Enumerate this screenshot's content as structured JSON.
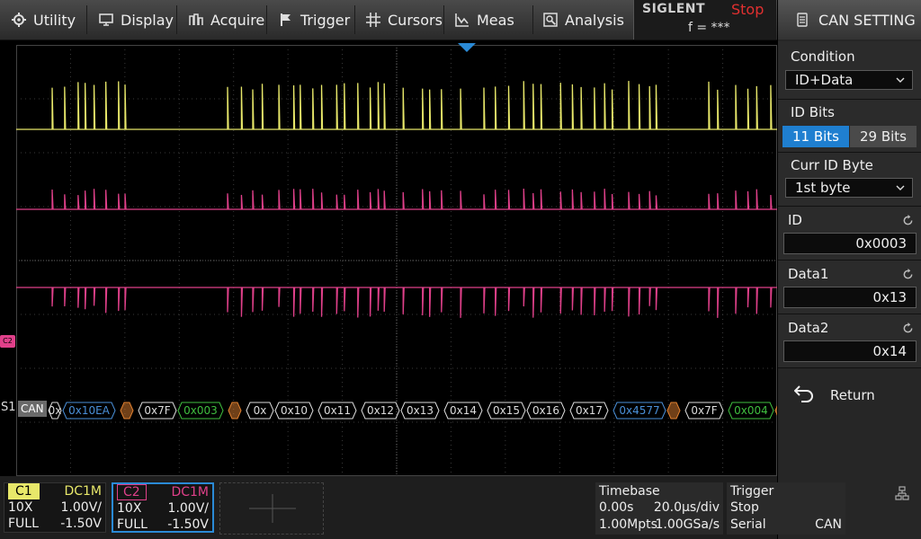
{
  "menu": {
    "items": [
      {
        "label": "Utility",
        "icon": "utility-icon"
      },
      {
        "label": "Display",
        "icon": "display-icon"
      },
      {
        "label": "Acquire",
        "icon": "acquire-icon"
      },
      {
        "label": "Trigger",
        "icon": "trigger-flag-icon"
      },
      {
        "label": "Cursors",
        "icon": "cursors-icon"
      },
      {
        "label": "Meas",
        "icon": "meas-icon"
      },
      {
        "label": "Analysis",
        "icon": "analysis-icon"
      }
    ],
    "brand": "SIGLENT",
    "run_state": "Stop",
    "freq_readout": "f = ***"
  },
  "panel": {
    "title": "CAN SETTING",
    "condition_label": "Condition",
    "condition_value": "ID+Data",
    "id_bits_label": "ID Bits",
    "id_bits_options": [
      "11 Bits",
      "29 Bits"
    ],
    "id_bits_selected": "11 Bits",
    "curr_id_byte_label": "Curr ID Byte",
    "curr_id_byte_value": "1st byte",
    "id_label": "ID",
    "id_value": "0x0003",
    "data1_label": "Data1",
    "data1_value": "0x13",
    "data2_label": "Data2",
    "data2_value": "0x14",
    "return_label": "Return"
  },
  "waveform": {
    "c2_marker": "C2",
    "bus_label": "S1",
    "protocol": "CAN",
    "frames": [
      {
        "text": "0x",
        "type": "start"
      },
      {
        "text": "0x10EA",
        "type": "id"
      },
      {
        "text": "",
        "type": "crc"
      },
      {
        "text": "0x7F",
        "type": "data"
      },
      {
        "text": "0x003",
        "type": "id-green"
      },
      {
        "text": "",
        "type": "crc"
      },
      {
        "text": "0x",
        "type": "data"
      },
      {
        "text": "0x10",
        "type": "data"
      },
      {
        "text": "0x11",
        "type": "data"
      },
      {
        "text": "0x12",
        "type": "data"
      },
      {
        "text": "0x13",
        "type": "data"
      },
      {
        "text": "0x14",
        "type": "data"
      },
      {
        "text": "0x15",
        "type": "data"
      },
      {
        "text": "0x16",
        "type": "data"
      },
      {
        "text": "0x17",
        "type": "data"
      },
      {
        "text": "0x4577",
        "type": "id"
      },
      {
        "text": "",
        "type": "crc"
      },
      {
        "text": "0x7F",
        "type": "data"
      },
      {
        "text": "0x004",
        "type": "id-green"
      },
      {
        "text": "",
        "type": "crc"
      }
    ],
    "colors": {
      "ch1": "#e8e86a",
      "ch2": "#e0408a",
      "bus_id": "#4a90d9",
      "bus_id_green": "#3fbf3f",
      "bus_crc": "#e08030",
      "grid": "#3a3a3a"
    }
  },
  "channels": [
    {
      "name": "C1",
      "coupling": "DC1M",
      "probe": "10X",
      "scale": "1.00V/",
      "bw": "FULL",
      "offset": "-1.50V",
      "color": "#e8e86a"
    },
    {
      "name": "C2",
      "coupling": "DC1M",
      "probe": "10X",
      "scale": "1.00V/",
      "bw": "FULL",
      "offset": "-1.50V",
      "color": "#e0408a"
    }
  ],
  "timebase": {
    "label": "Timebase",
    "delay": "0.00s",
    "scale": "20.0µs/div",
    "memory": "1.00Mpts",
    "sample_rate": "1.00GSa/s"
  },
  "trigger": {
    "label": "Trigger",
    "state": "Stop",
    "type": "Serial",
    "source": "CAN"
  }
}
